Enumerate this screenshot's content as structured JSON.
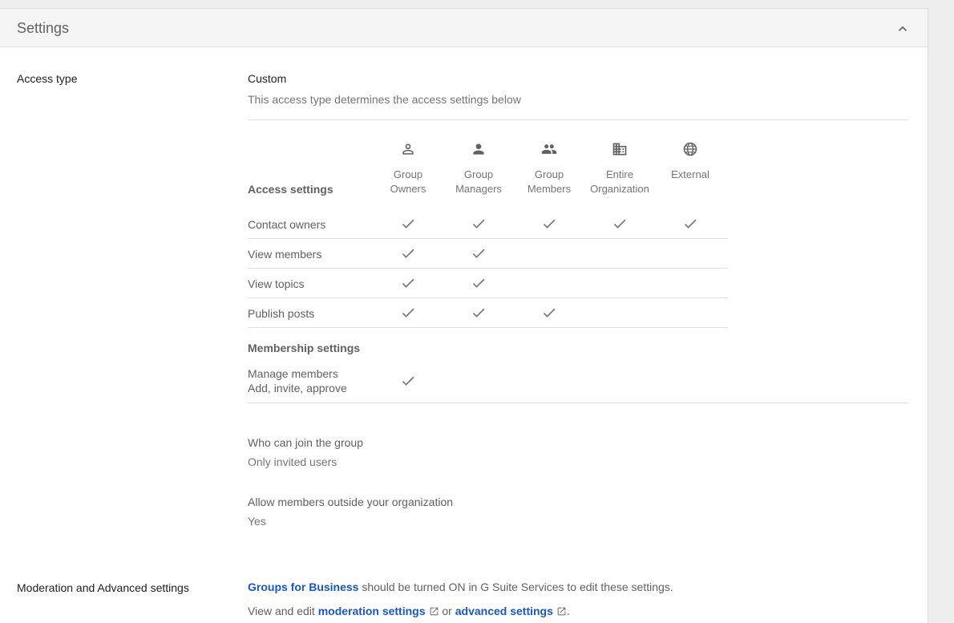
{
  "panel": {
    "title": "Settings"
  },
  "access_type": {
    "label": "Access type",
    "value": "Custom",
    "description": "This access type determines the access settings below"
  },
  "access_table": {
    "header": "Access settings",
    "columns": [
      {
        "icon": "person-outline-icon",
        "line1": "Group",
        "line2": "Owners"
      },
      {
        "icon": "person-icon",
        "line1": "Group",
        "line2": "Managers"
      },
      {
        "icon": "people-icon",
        "line1": "Group",
        "line2": "Members"
      },
      {
        "icon": "building-icon",
        "line1": "Entire",
        "line2": "Organization"
      },
      {
        "icon": "globe-icon",
        "line1": "External",
        "line2": ""
      }
    ],
    "rows": [
      {
        "label": "Contact owners",
        "checks": [
          true,
          true,
          true,
          true,
          true
        ]
      },
      {
        "label": "View members",
        "checks": [
          true,
          true,
          false,
          false,
          false
        ]
      },
      {
        "label": "View topics",
        "checks": [
          true,
          true,
          false,
          false,
          false
        ]
      },
      {
        "label": "Publish posts",
        "checks": [
          true,
          true,
          true,
          false,
          false
        ]
      }
    ],
    "membership_header": "Membership settings",
    "membership_rows": [
      {
        "label": "Manage members",
        "sublabel": "Add, invite, approve",
        "checks": [
          true,
          false,
          false,
          false,
          false
        ]
      }
    ]
  },
  "join": {
    "label": "Who can join the group",
    "value": "Only invited users"
  },
  "outside": {
    "label": "Allow members outside your organization",
    "value": "Yes"
  },
  "moderation": {
    "label": "Moderation and Advanced settings",
    "line1_link": "Groups for Business",
    "line1_rest": " should be turned ON in G Suite Services to edit these settings.",
    "line2_prefix": "View and edit ",
    "line2_link1": "moderation settings",
    "line2_mid": " or ",
    "line2_link2": "advanced settings",
    "line2_suffix": "."
  },
  "colors": {
    "link": "#1a56c4",
    "check": "#757575",
    "header_bg": "#f5f5f5"
  }
}
